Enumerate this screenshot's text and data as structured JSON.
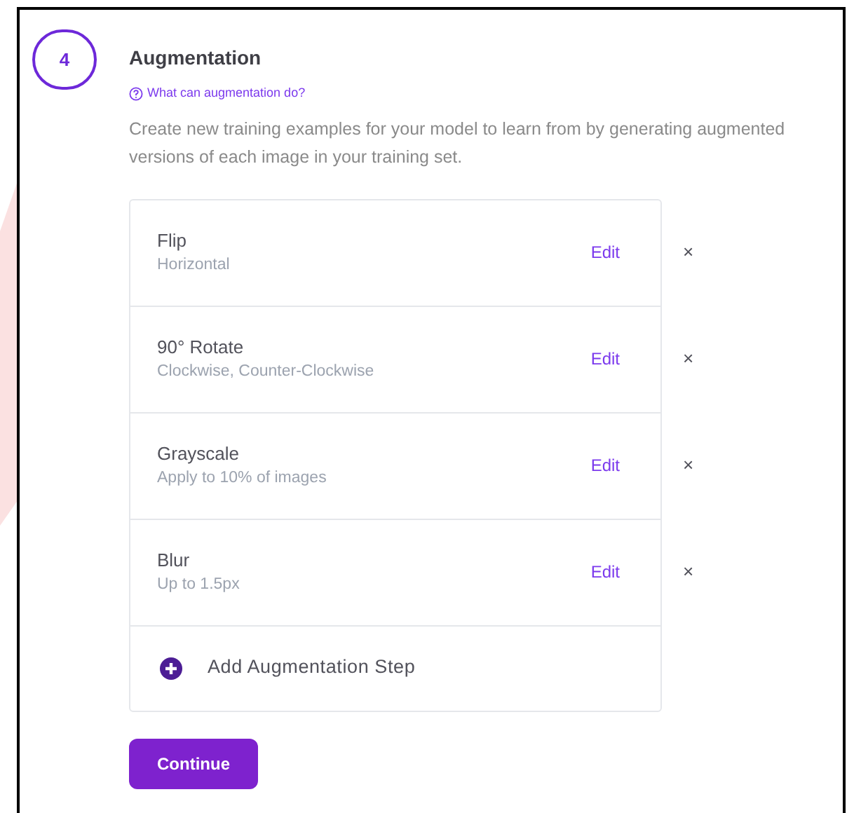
{
  "step": {
    "number": "4",
    "title": "Augmentation",
    "help_link": "What can augmentation do?",
    "description": "Create new training examples for your model to learn from by generating augmented versions of each image in your training set."
  },
  "augmentations": [
    {
      "name": "Flip",
      "detail": "Horizontal",
      "edit": "Edit",
      "remove": "×"
    },
    {
      "name": "90° Rotate",
      "detail": "Clockwise, Counter-Clockwise",
      "edit": "Edit",
      "remove": "×"
    },
    {
      "name": "Grayscale",
      "detail": "Apply to 10% of images",
      "edit": "Edit",
      "remove": "×"
    },
    {
      "name": "Blur",
      "detail": "Up to 1.5px",
      "edit": "Edit",
      "remove": "×"
    }
  ],
  "add_step": "Add Augmentation Step",
  "continue_button": "Continue"
}
